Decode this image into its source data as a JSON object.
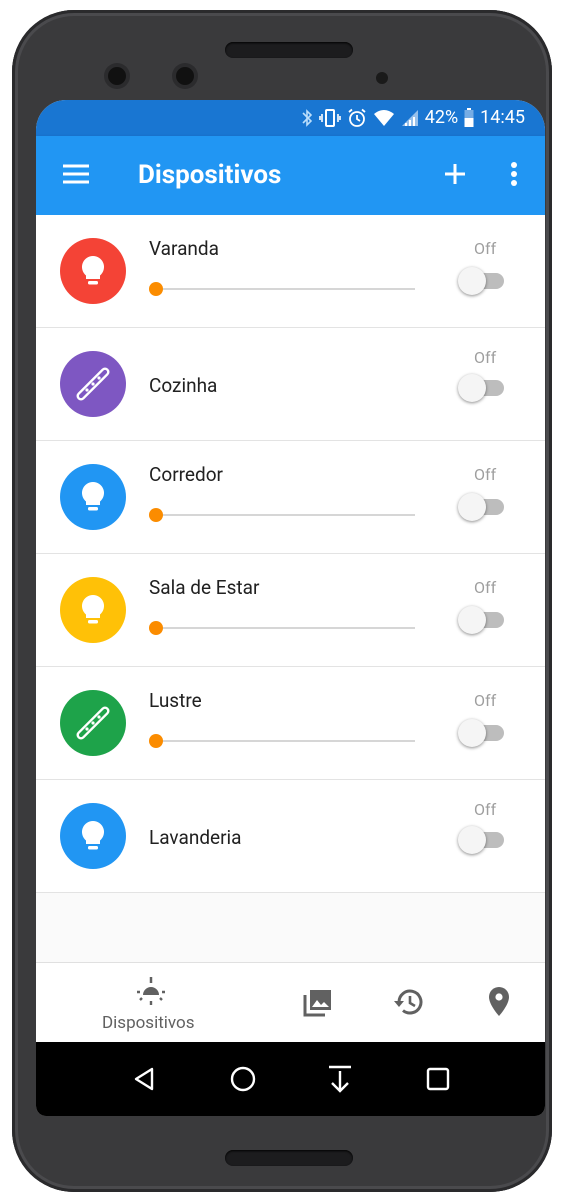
{
  "status_bar": {
    "battery": "42%",
    "time": "14:45",
    "icons": [
      "bluetooth-icon",
      "vibrate-icon",
      "alarm-icon",
      "wifi-icon",
      "signal-icon",
      "battery-icon"
    ]
  },
  "app_bar": {
    "title": "Dispositivos",
    "color": "#2196f3",
    "status_color": "#1976d2"
  },
  "devices": [
    {
      "name": "Varanda",
      "icon": "lightbulb-icon",
      "color": "#f44336",
      "has_slider": true,
      "brightness": 0,
      "state": "Off"
    },
    {
      "name": "Cozinha",
      "icon": "led-strip-icon",
      "color": "#7e57c2",
      "has_slider": false,
      "state": "Off"
    },
    {
      "name": "Corredor",
      "icon": "lightbulb-icon",
      "color": "#2196f3",
      "has_slider": true,
      "brightness": 0,
      "state": "Off"
    },
    {
      "name": "Sala de Estar",
      "icon": "lightbulb-icon",
      "color": "#ffc107",
      "has_slider": true,
      "brightness": 0,
      "state": "Off"
    },
    {
      "name": "Lustre",
      "icon": "led-strip-icon",
      "color": "#1ea34a",
      "has_slider": true,
      "brightness": 0,
      "state": "Off"
    },
    {
      "name": "Lavanderia",
      "icon": "lightbulb-icon",
      "color": "#2196f3",
      "has_slider": false,
      "state": "Off"
    }
  ],
  "bottom_nav": {
    "active_label": "Dispositivos",
    "items": [
      "devices-icon",
      "gallery-icon",
      "history-icon",
      "location-icon"
    ]
  },
  "system_nav": [
    "back-icon",
    "home-icon",
    "download-icon",
    "recents-icon"
  ]
}
